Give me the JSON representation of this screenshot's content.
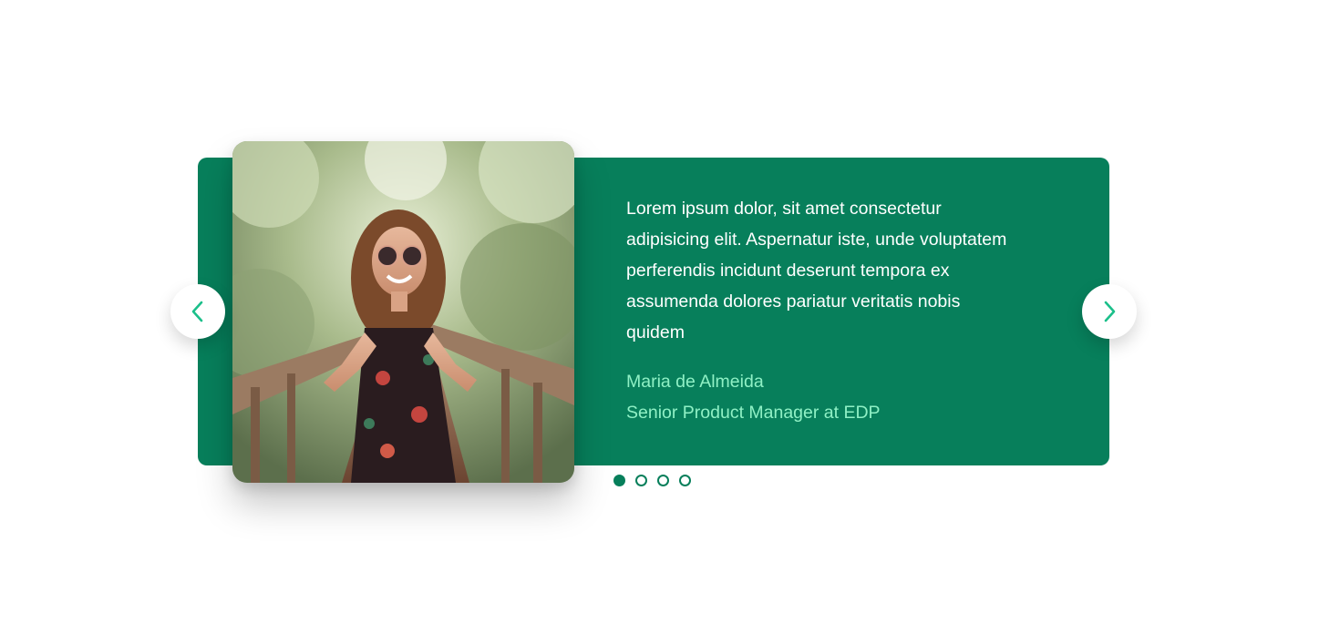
{
  "testimonial": {
    "quote": "Lorem ipsum dolor, sit amet consectetur adipisicing elit. Aspernatur iste, unde voluptatem perferendis incidunt deserunt tempora ex assumenda dolores pariatur veritatis nobis quidem",
    "author_name": "Maria de Almeida",
    "author_title": "Senior Product Manager at EDP"
  },
  "navigation": {
    "prev_icon": "chevron-left-icon",
    "next_icon": "chevron-right-icon"
  },
  "pagination": {
    "total": 4,
    "active_index": 0
  },
  "colors": {
    "card_background": "#077f5b",
    "quote_text": "#ffffff",
    "author_text": "#8ff0c5",
    "arrow": "#1bbf8a"
  }
}
